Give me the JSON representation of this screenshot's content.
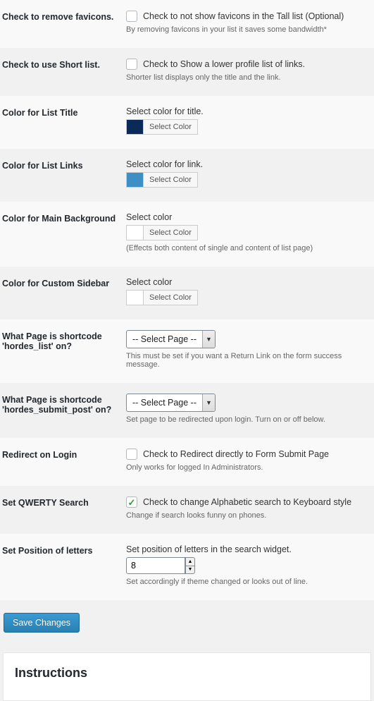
{
  "settings": {
    "removeFavicons": {
      "label": "Check to remove favicons.",
      "optionText": "Check to not show favicons in the Tall list (Optional)",
      "description": "By removing favicons in your list it saves some bandwidth*",
      "checked": false
    },
    "shortList": {
      "label": "Check to use Short list.",
      "optionText": "Check to Show a lower profile list of links.",
      "description": "Shorter list displays only the title and the link.",
      "checked": false
    },
    "titleColor": {
      "label": "Color for List Title",
      "controlText": "Select color for title.",
      "btn": "Select Color",
      "swatch": "#0a2b5a"
    },
    "linkColor": {
      "label": "Color for List Links",
      "controlText": "Select color for link.",
      "btn": "Select Color",
      "swatch": "#3d8fc5"
    },
    "mainBg": {
      "label": "Color for Main Background",
      "controlText": "Select color",
      "btn": "Select Color",
      "swatch": "#ffffff",
      "description": "(Effects both content of single and content of list page)"
    },
    "sidebarColor": {
      "label": "Color for Custom Sidebar",
      "controlText": "Select color",
      "btn": "Select Color",
      "swatch": "#ffffff"
    },
    "pageList": {
      "label": "What Page is shortcode 'hordes_list' on?",
      "selected": "-- Select Page --",
      "description": "This must be set if you want a Return Link on the form success message."
    },
    "pageSubmit": {
      "label": "What Page is shortcode 'hordes_submit_post' on?",
      "selected": "-- Select Page --",
      "description": "Set page to be redirected upon login. Turn on or off below."
    },
    "redirectLogin": {
      "label": "Redirect on Login",
      "optionText": "Check to Redirect directly to Form Submit Page",
      "description": "Only works for logged In Administrators.",
      "checked": false
    },
    "qwerty": {
      "label": "Set QWERTY Search",
      "optionText": "Check to change Alphabetic search to Keyboard style",
      "description": "Change if search looks funny on phones.",
      "checked": true
    },
    "letterPos": {
      "label": "Set Position of letters",
      "controlText": "Set position of letters in the search widget.",
      "value": "8",
      "description": "Set accordingly if theme changed or looks out of line."
    }
  },
  "saveBtn": "Save Changes",
  "instructionsHeading": "Instructions"
}
